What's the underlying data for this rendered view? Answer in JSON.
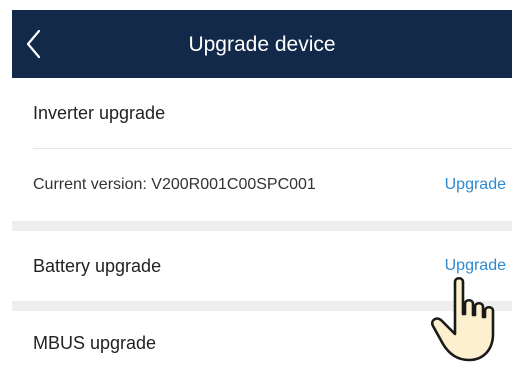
{
  "header": {
    "title": "Upgrade device",
    "background": "#13294a",
    "back_icon": "chevron-left-icon"
  },
  "sections": {
    "inverter": {
      "label": "Inverter upgrade",
      "current_version_label": "Current version:  V200R001C00SPC001",
      "action_label": "Upgrade"
    },
    "battery": {
      "label": "Battery upgrade",
      "action_label": "Upgrade"
    },
    "mbus": {
      "label": "MBUS upgrade"
    }
  },
  "colors": {
    "link": "#2d8ad2",
    "separator": "#eeeeee"
  },
  "pointer_icon": "hand-pointer-icon"
}
